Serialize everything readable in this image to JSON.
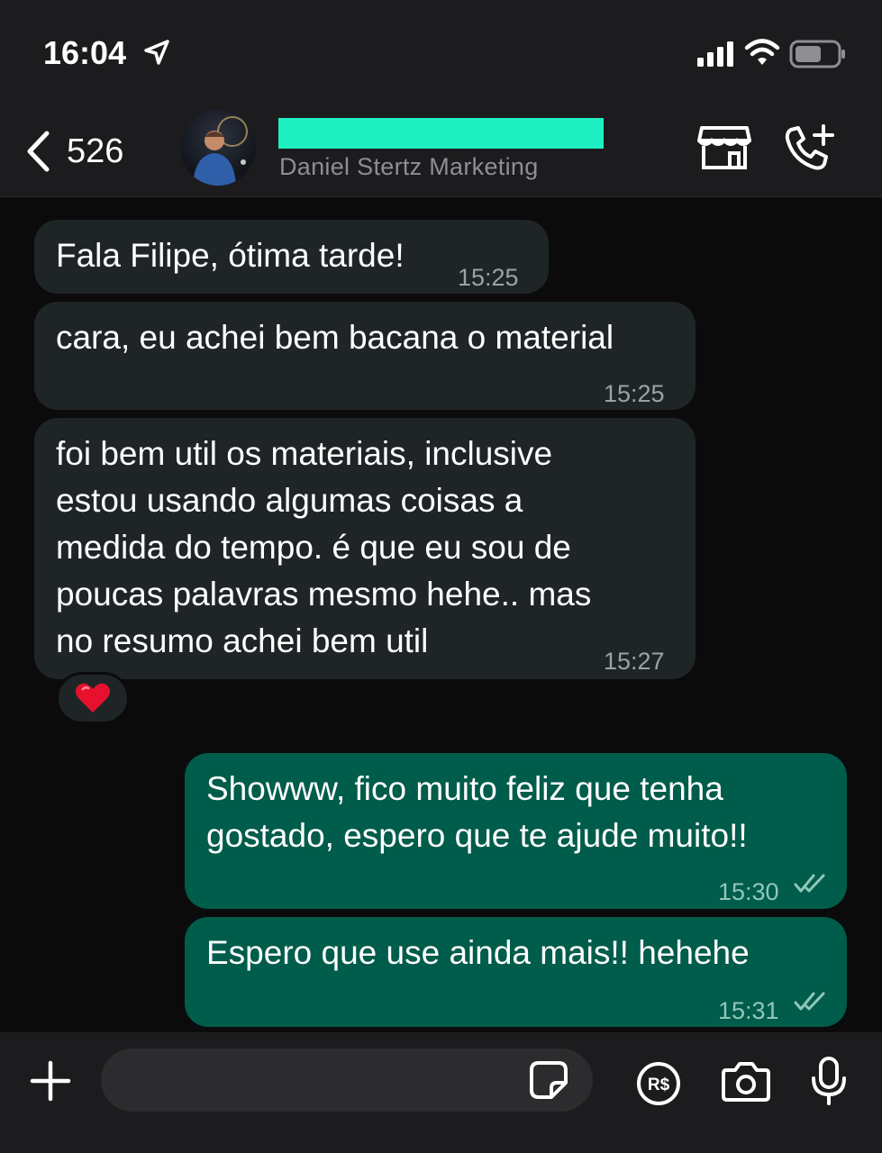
{
  "status_bar": {
    "time": "16:04"
  },
  "header": {
    "back_count": "526",
    "contact_subtitle": "Daniel Stertz Marketing"
  },
  "messages": [
    {
      "direction": "incoming",
      "text": "Fala Filipe, ótima tarde!",
      "time": "15:25"
    },
    {
      "direction": "incoming",
      "text": "cara, eu achei bem bacana o material",
      "time": "15:25"
    },
    {
      "direction": "incoming",
      "text": "foi bem util os materiais, inclusive\nestou usando algumas coisas a\nmedida do tempo. é que eu sou de\npoucas palavras mesmo hehe.. mas\nno resumo achei bem util",
      "time": "15:27",
      "reaction": "❤️"
    },
    {
      "direction": "outgoing",
      "text": "Showww, fico muito feliz que tenha\ngostado, espero que te ajude muito!!",
      "time": "15:30",
      "status": "read"
    },
    {
      "direction": "outgoing",
      "text": "Espero que use ainda mais!! hehehe",
      "time": "15:31",
      "status": "read"
    }
  ],
  "composer": {
    "placeholder": "",
    "value": ""
  },
  "icons": {
    "status": [
      "location-arrow-icon",
      "cellular-signal-icon",
      "wifi-icon",
      "battery-icon"
    ],
    "header": [
      "chevron-left-icon",
      "store-icon",
      "add-call-icon"
    ],
    "composer": [
      "plus-icon",
      "sticker-icon",
      "payment-icon",
      "camera-icon",
      "microphone-icon"
    ]
  },
  "colors": {
    "incoming_bubble": "#1f2527",
    "outgoing_bubble": "#005c4b",
    "redaction": "#1ff0c2",
    "background": "#0b0b0b"
  }
}
